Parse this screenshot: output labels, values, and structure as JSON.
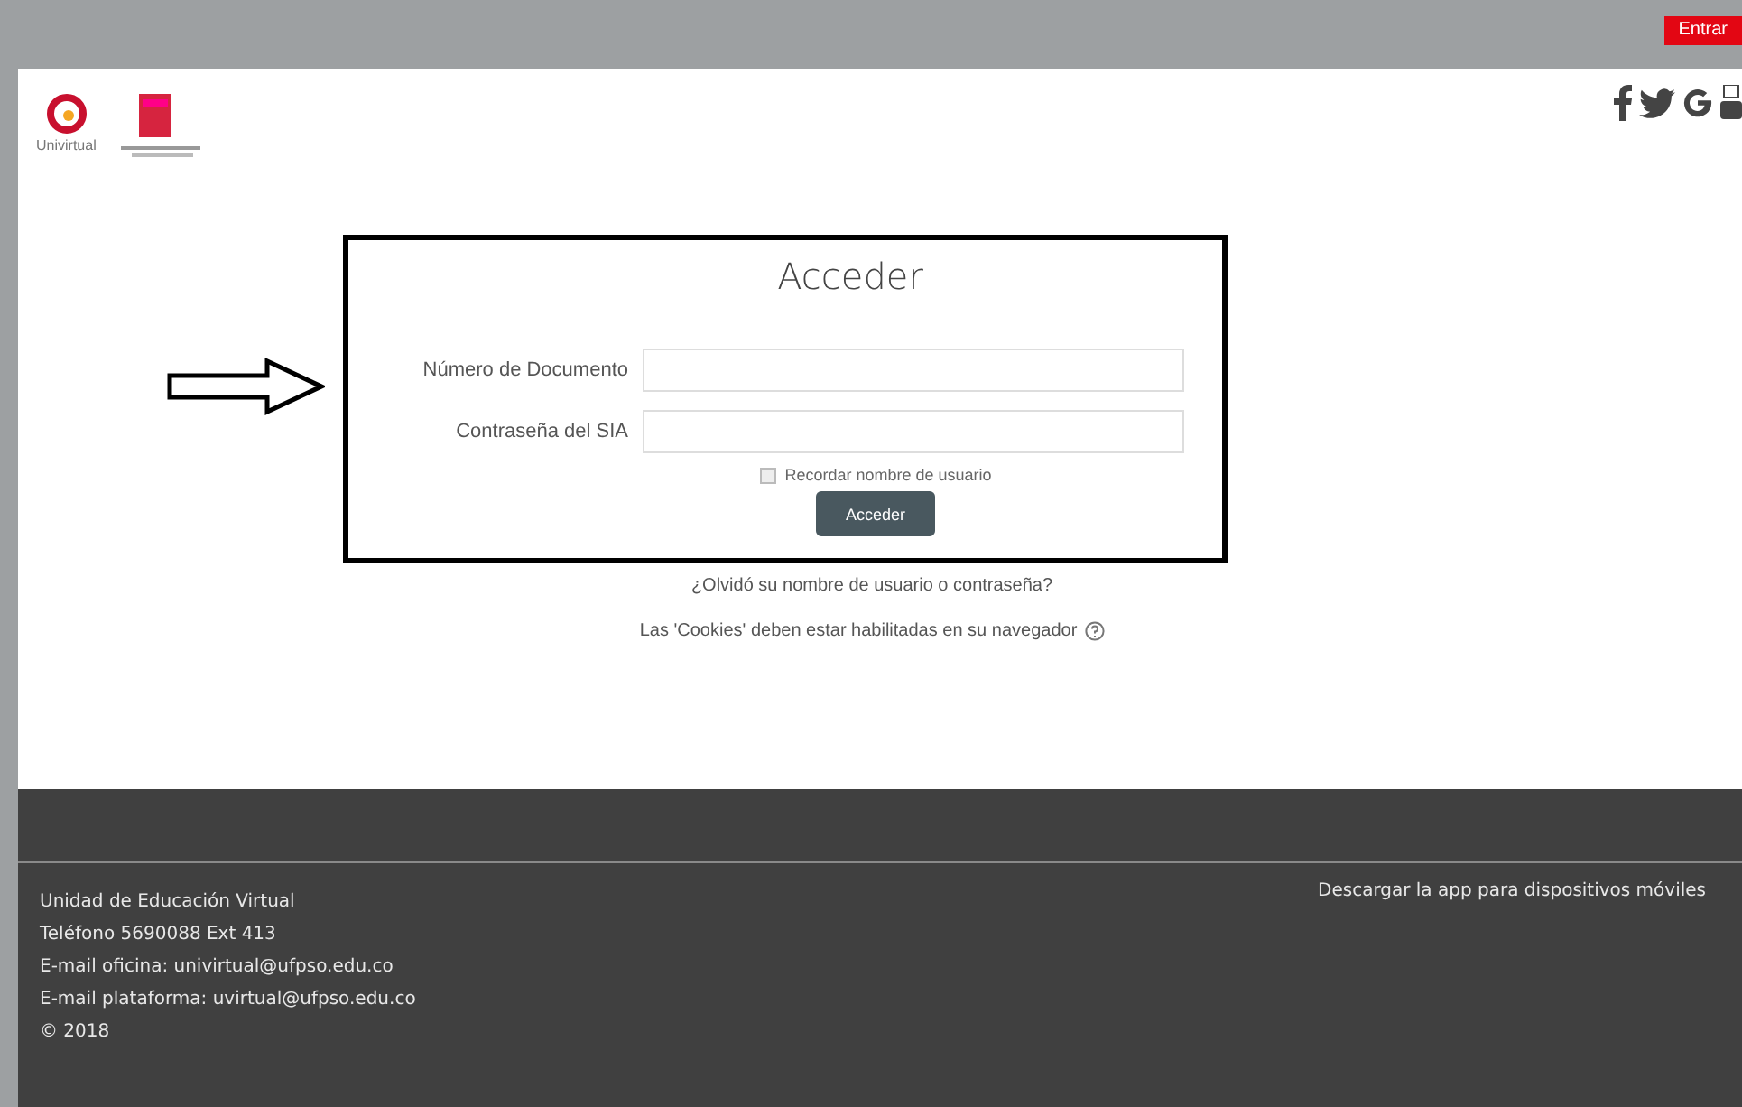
{
  "top_bar": {
    "login_button": "Entrar"
  },
  "header": {
    "logo_text": "Univirtual"
  },
  "login": {
    "title": "Acceder",
    "fields": [
      {
        "label": "Número de Documento"
      },
      {
        "label": "Contraseña del SIA"
      }
    ],
    "remember": {
      "label": "Recordar nombre de usuario",
      "checked": false
    },
    "submit": "Acceder",
    "forgot_link": "¿Olvidó su nombre de usuario o contraseña?",
    "cookies_note": "Las 'Cookies' deben estar habilitadas en su navegador"
  },
  "footer": {
    "lines": [
      "Unidad de Educación Virtual",
      "Teléfono 5690088 Ext 413",
      "E-mail oficina: univirtual@ufpso.edu.co",
      "E-mail plataforma: uvirtual@ufpso.edu.co",
      "© 2018"
    ],
    "app_link": "Descargar la app para dispositivos móviles"
  }
}
